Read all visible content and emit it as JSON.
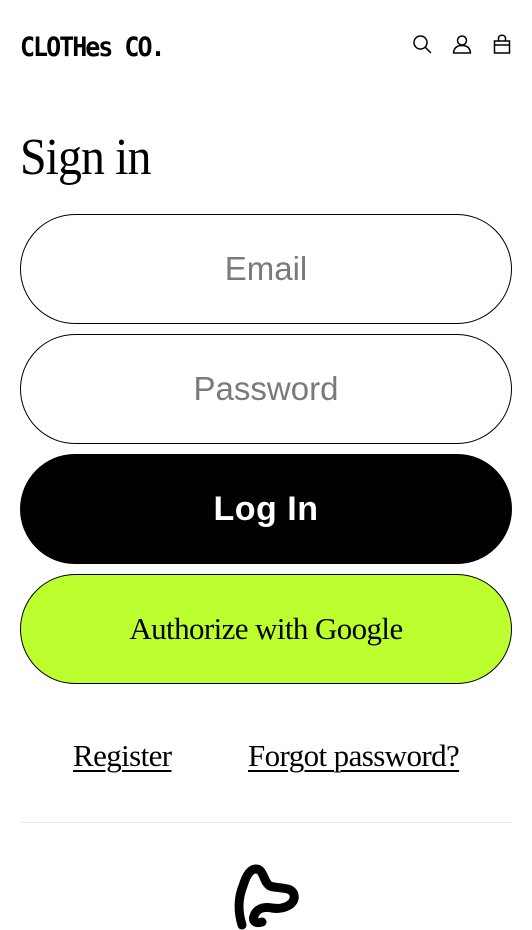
{
  "header": {
    "brand": "CLOTHes CO.",
    "icons": [
      "search-icon",
      "account-icon",
      "cart-icon"
    ]
  },
  "main": {
    "title": "Sign in",
    "email": {
      "placeholder": "Email",
      "value": ""
    },
    "password": {
      "placeholder": "Password",
      "value": ""
    },
    "login_label": "Log In",
    "google_label": "Authorize with Google",
    "register_link": "Register",
    "forgot_link": "Forgot password?"
  },
  "footer": {
    "logo_icon": "brand-mark-icon"
  },
  "colors": {
    "accent": "#bdff2e",
    "primary_button": "#000000",
    "placeholder": "#7a7a7a"
  }
}
